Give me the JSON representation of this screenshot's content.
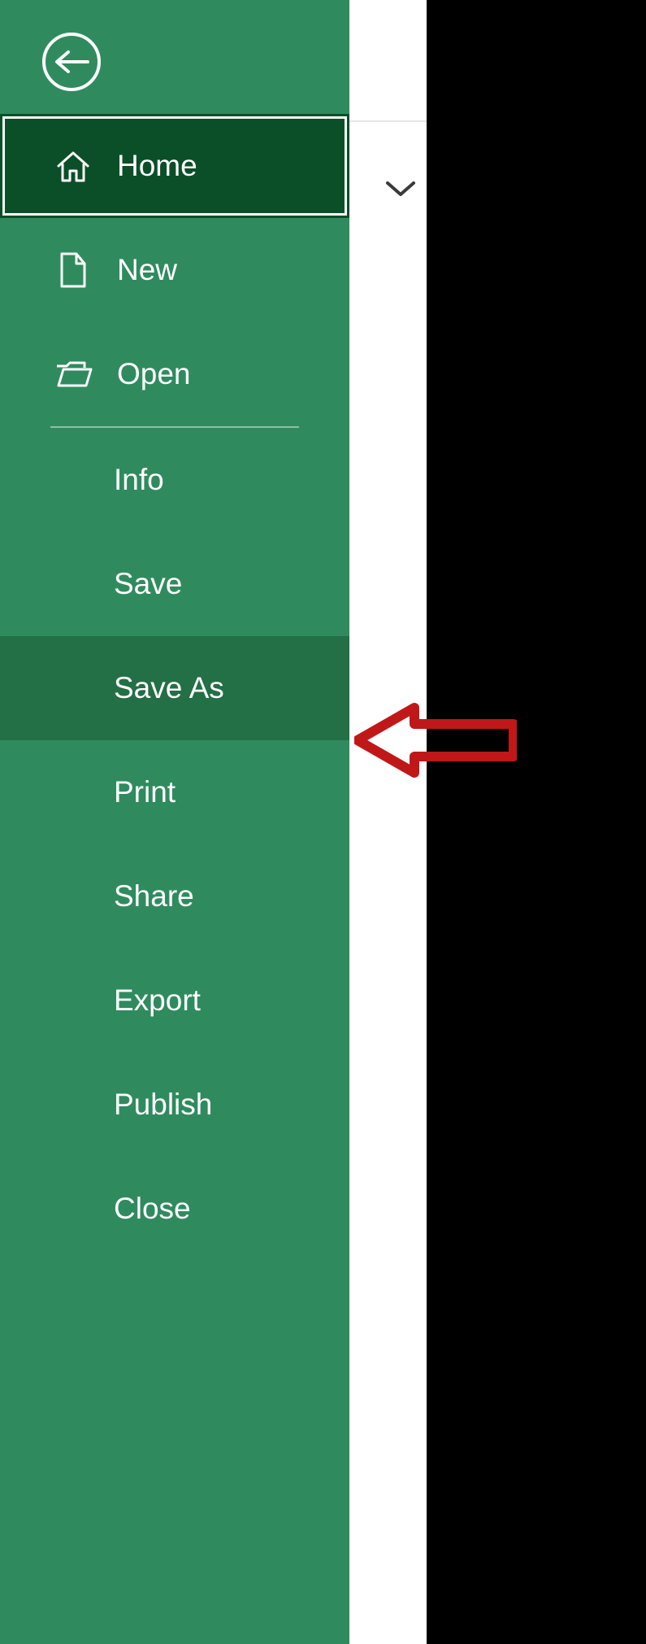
{
  "sidebar": {
    "home": "Home",
    "new": "New",
    "open": "Open",
    "info": "Info",
    "save": "Save",
    "save_as": "Save As",
    "print": "Print",
    "share": "Share",
    "export": "Export",
    "publish": "Publish",
    "close": "Close"
  },
  "colors": {
    "sidebar_bg": "#2f8b5e",
    "selected_bg": "#0b4f28",
    "highlight_bg": "#236f46",
    "annotation_arrow": "#c01818"
  },
  "annotation": {
    "points_to": "save_as"
  }
}
